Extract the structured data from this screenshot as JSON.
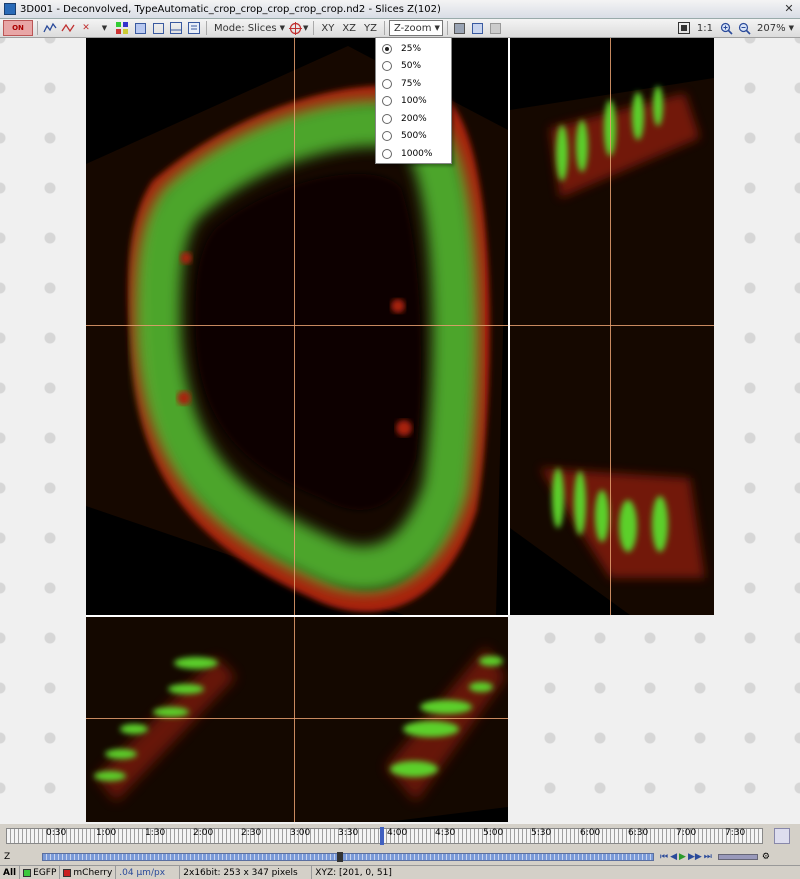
{
  "window": {
    "title": "3D001 - Deconvolved, TypeAutomatic_crop_crop_crop_crop_crop.nd2 - Slices  Z(102)"
  },
  "toolbar": {
    "on_label": "ON",
    "mode_label": "Mode: Slices",
    "view_buttons": [
      "XY",
      "XZ",
      "YZ"
    ],
    "zzoom_label": "Z-zoom",
    "ratio_label": "1:1",
    "zoom_value": "207%"
  },
  "zzoom_menu": {
    "options": [
      "25%",
      "50%",
      "75%",
      "100%",
      "200%",
      "500%",
      "1000%"
    ],
    "selected": "25%"
  },
  "timeline": {
    "labels": [
      "0:30",
      "1:00",
      "1:30",
      "2:00",
      "2:30",
      "3:00",
      "3:30",
      "4:00",
      "4:30",
      "5:00",
      "5:30",
      "6:00",
      "6:30",
      "7:00",
      "7:30"
    ]
  },
  "zbar": {
    "label": "Z"
  },
  "status": {
    "all_tab": "All",
    "channel1": "EGFP",
    "channel2": "mCherry",
    "scale": ".04 µm/px",
    "bitdepth": "2x16bit: 253 x 347 pixels",
    "coords": "XYZ: [201, 0, 51]"
  },
  "colors": {
    "egfp": "#3cc83c",
    "mcherry": "#c82020",
    "crosshair": "#e8a070",
    "accent": "#3a5aa0"
  }
}
